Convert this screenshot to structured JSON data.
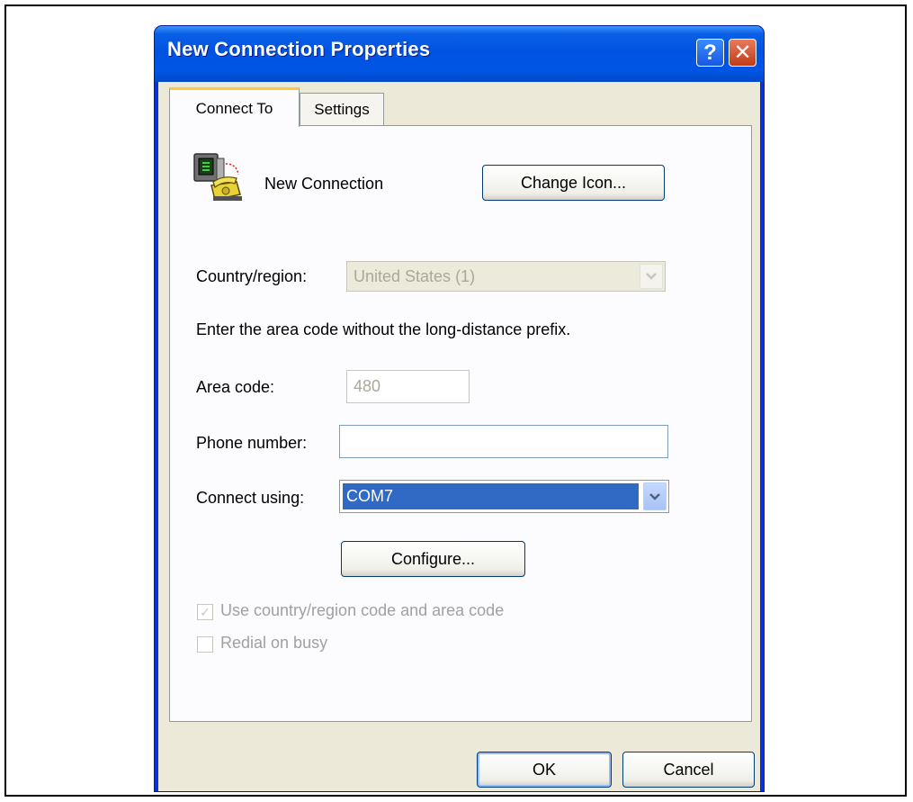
{
  "window": {
    "title": "New Connection Properties"
  },
  "title_buttons": {
    "help_label": "?",
    "close_label": "✕"
  },
  "tabs": [
    {
      "label": "Connect To",
      "active": true
    },
    {
      "label": "Settings",
      "active": false
    }
  ],
  "connection": {
    "name": "New Connection",
    "change_icon_label": "Change Icon..."
  },
  "country": {
    "label": "Country/region:",
    "value": "United States (1)",
    "enabled": false
  },
  "instruction": "Enter the area code without the long-distance prefix.",
  "area_code": {
    "label": "Area code:",
    "value": "480",
    "enabled": false
  },
  "phone_number": {
    "label": "Phone number:",
    "value": ""
  },
  "connect_using": {
    "label": "Connect using:",
    "value": "COM7"
  },
  "configure_label": "Configure...",
  "options": {
    "use_country_code": {
      "label": "Use country/region code and area code",
      "checked": true,
      "enabled": false
    },
    "redial_on_busy": {
      "label": "Redial on busy",
      "checked": false,
      "enabled": false
    }
  },
  "dialog_buttons": {
    "ok_label": "OK",
    "cancel_label": "Cancel"
  },
  "icons": {
    "connection": "phone-computer-icon",
    "dropdown": "chevron-down-icon"
  },
  "colors": {
    "title_bar": "#0055e5",
    "dialog_bg": "#ece9d8",
    "selection": "#316ac5"
  }
}
